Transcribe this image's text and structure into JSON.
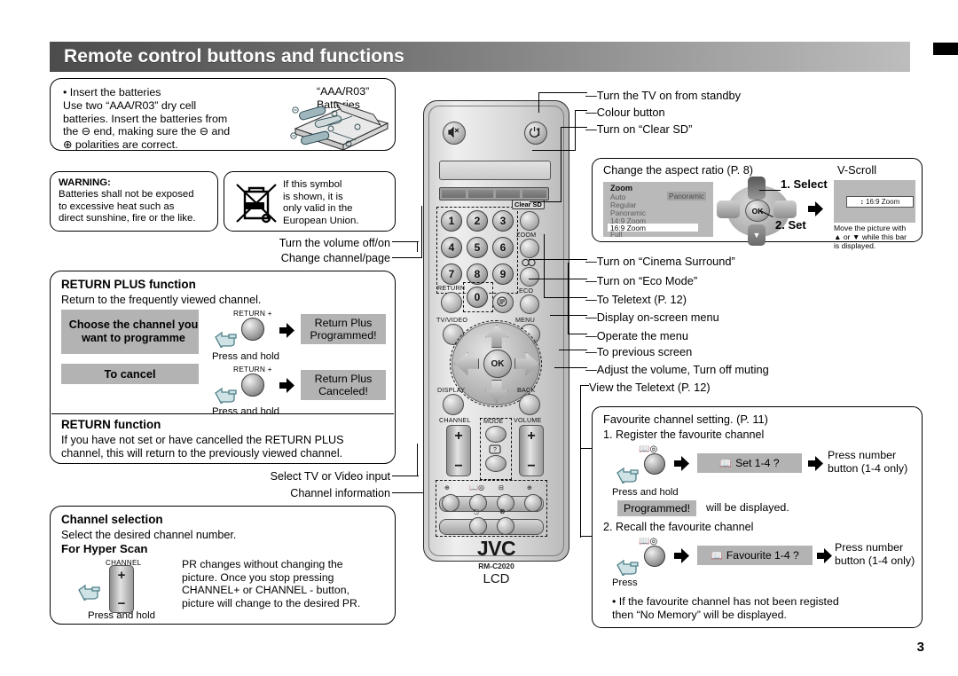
{
  "header": {
    "title": "Remote control buttons and functions"
  },
  "page_number": "3",
  "battery": {
    "text": "• Insert the batteries\n  Use two “AAA/R03” dry cell\n  batteries. Insert the batteries from\n  the ⊖ end, making sure the ⊖ and\n  ⊕ polarities are correct.",
    "callout": "“AAA/R03”\nBatteries"
  },
  "warning": {
    "title": "WARNING:",
    "text": "Batteries shall not be exposed\nto excessive heat such as\ndirect sunshine, fire or the like."
  },
  "eu_notice": {
    "text": "If this symbol\nis shown, it is\nonly valid in the\nEuropean Union.",
    "icon": "crossed-out-wheelie-bin-icon"
  },
  "left_connectors": {
    "volume": "Turn the volume off/on",
    "channel": "Change channel/page",
    "tv_video": "Select TV or Video input",
    "channel_info": "Channel information"
  },
  "return_plus": {
    "title": "RETURN PLUS function",
    "subtitle": "Return to the frequently viewed channel.",
    "step1_chip": "Choose the channel\nyou want to\nprogramme",
    "step1_button_label": "RETURN +",
    "step1_action": "Press and hold",
    "step1_result": "Return Plus\nProgrammed!",
    "step2_chip": "To cancel",
    "step2_button_label": "RETURN +",
    "step2_action": "Press and hold",
    "step2_result": "Return Plus\nCanceled!",
    "return_title": "RETURN function",
    "return_text": "If you have not set or have cancelled the RETURN PLUS\nchannel, this will return to the previously viewed channel."
  },
  "channel_selection": {
    "title": "Channel selection",
    "subtitle": "Select the desired channel number.",
    "hyper_scan": "For Hyper Scan",
    "button_label": "CHANNEL",
    "action": "Press and hold",
    "body": "PR changes without changing the\npicture. Once you stop pressing\nCHANNEL+ or CHANNEL - button,\npicture will change to the desired PR."
  },
  "remote": {
    "brand": "JVC",
    "model": "RM-C2020",
    "type": "LCD",
    "numbers": [
      "1",
      "2",
      "3",
      "4",
      "5",
      "6",
      "7",
      "8",
      "9",
      "0"
    ],
    "labels": {
      "clear_sd": "Clear SD",
      "zoom": "ZOOM",
      "eco": "ECO",
      "return": "RETURN",
      "tv_video": "TV/VIDEO",
      "menu": "MENU",
      "display": "DISPLAY",
      "back": "BACK",
      "channel": "CHANNEL",
      "volume": "VOLUME",
      "mode": "MODE",
      "ok": "OK",
      "plus": "+",
      "minus": "−"
    },
    "icons": {
      "mute": "mute-icon",
      "power": "power-standby-icon",
      "teletext": "teletext-icon",
      "cinema": "cinema-surround-icon",
      "help": "help-question-icon"
    }
  },
  "right_callouts": [
    "Turn the TV on from standby",
    "Colour button",
    "Turn on “Clear SD”"
  ],
  "right_callouts2": [
    "Turn on “Cinema Surround”",
    "Turn on “Eco Mode”",
    "To Teletext (P. 12)",
    "Display on-screen menu",
    "Operate the menu",
    "To previous screen",
    "Adjust the volume, Turn off muting",
    "View the Teletext (P. 12)"
  ],
  "aspect": {
    "title": "Change the aspect ratio (P. 8)",
    "vscroll_title": "V-Scroll",
    "menu_heading": "Zoom",
    "menu_items": [
      "Auto",
      "Regular",
      "Panoramic",
      "14:9 Zoom",
      "16:9 Zoom",
      "Full"
    ],
    "menu_selected": "16:9 Zoom",
    "menu_current_value": "Panoramic",
    "step1": "1. Select",
    "step2": "2. Set",
    "ok_label": "OK",
    "vscroll_bar": "↕ 16:9 Zoom",
    "vscroll_note": "Move the picture with\n▲ or ▼ while this bar\nis displayed."
  },
  "favourite": {
    "title": "Favourite channel setting. (P. 11)",
    "step1_title": "1. Register the favourite channel",
    "step1_action": "Press and hold",
    "step1_chip": "Set 1-4 ?",
    "step1_result": "Press number\nbutton (1-4 only)",
    "programmed_chip": "Programmed!",
    "programmed_text": "will be displayed.",
    "step2_title": "2. Recall the favourite channel",
    "step2_action": "Press",
    "step2_chip": "Favourite 1-4 ?",
    "step2_result": "Press number\nbutton (1-4 only)",
    "note": "• If the favourite channel has not been registed\n  then “No Memory” will be displayed."
  }
}
